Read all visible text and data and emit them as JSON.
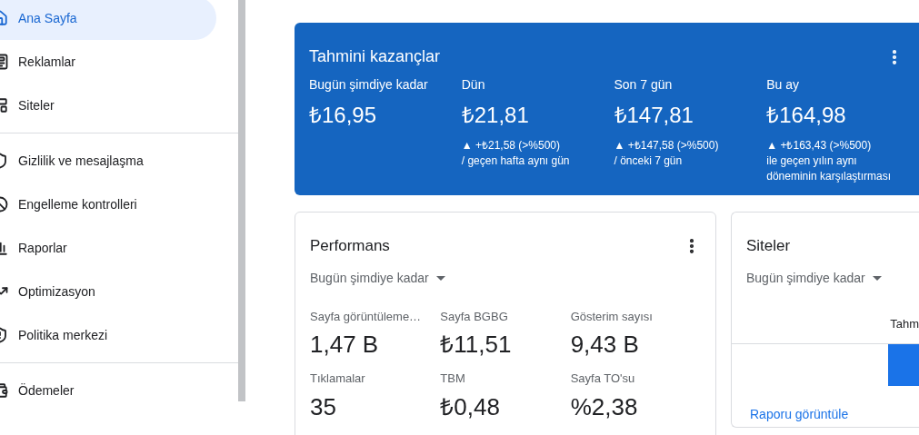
{
  "sidebar": {
    "groups": [
      {
        "items": [
          {
            "label": "Ana Sayfa",
            "selected": true
          },
          {
            "label": "Reklamlar",
            "selected": false
          },
          {
            "label": "Siteler",
            "selected": false
          }
        ]
      },
      {
        "items": [
          {
            "label": "Gizlilik ve mesajlaşma",
            "selected": false
          },
          {
            "label": "Engelleme kontrolleri",
            "selected": false
          },
          {
            "label": "Raporlar",
            "selected": false
          },
          {
            "label": "Optimizasyon",
            "selected": false
          },
          {
            "label": "Politika merkezi",
            "selected": false
          }
        ]
      },
      {
        "items": [
          {
            "label": "Ödemeler",
            "selected": false
          }
        ]
      }
    ]
  },
  "earnings": {
    "title": "Tahmini kazançlar",
    "stats": [
      {
        "label": "Bugün şimdiye kadar",
        "value": "₺16,95"
      },
      {
        "label": "Dün",
        "value": "₺21,81",
        "change": "▲ +₺21,58 (>%500)",
        "compare": "/ geçen hafta aynı gün"
      },
      {
        "label": "Son 7 gün",
        "value": "₺147,81",
        "change": "▲ +₺147,58 (>%500)",
        "compare": "/ önceki 7 gün"
      },
      {
        "label": "Bu ay",
        "value": "₺164,98",
        "change": "▲ +₺163,43 (>%500)",
        "compare": "ile geçen yılın aynı döneminin karşılaştırması"
      }
    ]
  },
  "performance": {
    "title": "Performans",
    "period": "Bugün şimdiye kadar",
    "metrics": [
      {
        "label": "Sayfa görüntüleme…",
        "value": "1,47 B"
      },
      {
        "label": "Sayfa BGBG",
        "value": "₺11,51"
      },
      {
        "label": "Gösterim sayısı",
        "value": "9,43 B"
      },
      {
        "label": "Tıklamalar",
        "value": "35"
      },
      {
        "label": "TBM",
        "value": "₺0,48"
      },
      {
        "label": "Sayfa TO'su",
        "value": "%2,38"
      }
    ]
  },
  "sites": {
    "title": "Siteler",
    "period": "Bugün şimdiye kadar",
    "column_1": "Tahm",
    "link": "Raporu görüntüle"
  }
}
